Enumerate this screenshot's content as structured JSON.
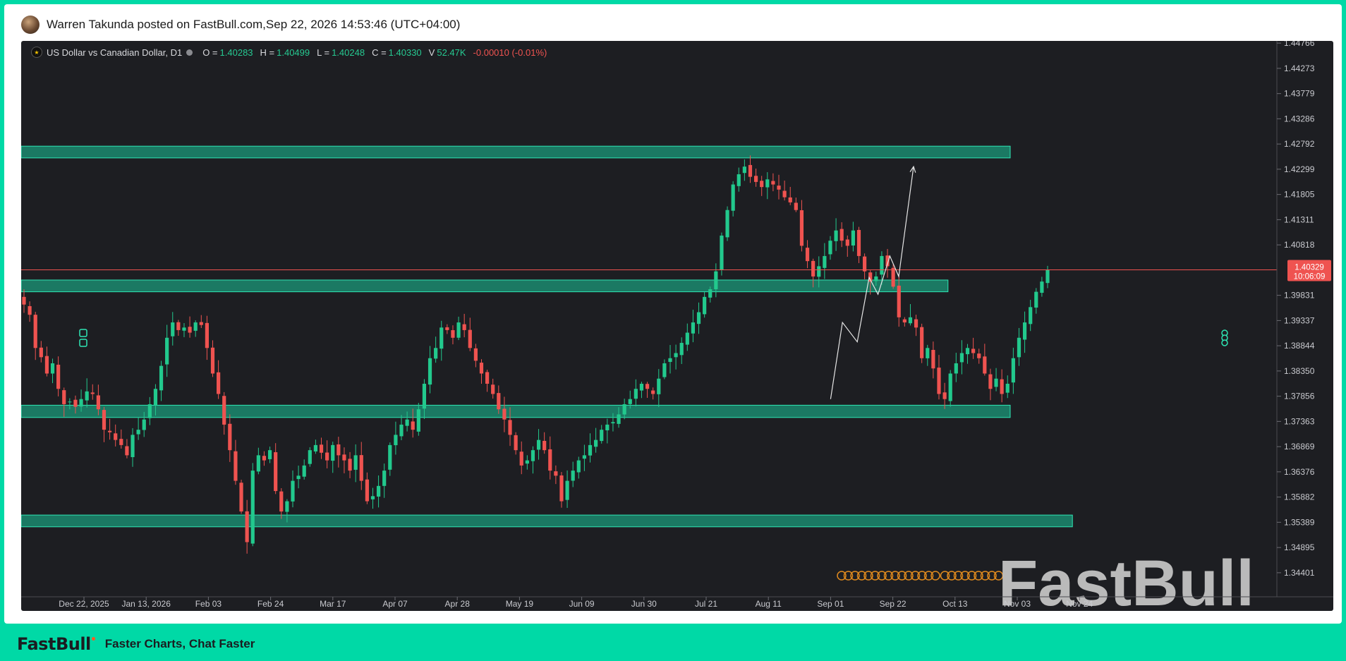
{
  "post": {
    "author_line": "Warren Takunda posted on FastBull.com",
    "separator": ",",
    "timestamp": "Sep 22, 2026 14:53:46 (UTC+04:00)"
  },
  "header": {
    "symbol": "US Dollar vs Canadian Dollar, D1",
    "o_label": "O =",
    "o_value": "1.40283",
    "h_label": "H =",
    "h_value": "1.40499",
    "l_label": "L =",
    "l_value": "1.40248",
    "c_label": "C =",
    "c_value": "1.40330",
    "v_label": "V",
    "v_value": "52.47K",
    "change": "-0.00010 (-0.01%)"
  },
  "colors": {
    "up": "#26a69a",
    "up_bright": "#22c98d",
    "down": "#ef5350",
    "zone_fill": "#1b8a6f",
    "zone_stroke": "#2ee6b4",
    "price_line": "#ef5350",
    "background": "#1d1e22",
    "frame": "#00d9a6"
  },
  "chart_data": {
    "type": "candlestick",
    "title": "US Dollar vs Canadian Dollar, D1",
    "ylim": [
      1.3393,
      1.4481
    ],
    "y_ticks": [
      "1.44766",
      "1.44273",
      "1.43779",
      "1.43286",
      "1.42792",
      "1.42299",
      "1.41805",
      "1.41311",
      "1.40818",
      "1.39831",
      "1.39337",
      "1.38844",
      "1.38350",
      "1.37856",
      "1.37363",
      "1.36869",
      "1.36376",
      "1.35882",
      "1.35389",
      "1.34895",
      "1.34401"
    ],
    "x_ticks": [
      "Dec 22, 2025",
      "Jan 13, 2026",
      "Feb 03",
      "Feb 24",
      "Mar 17",
      "Apr 07",
      "Apr 28",
      "May 19",
      "Jun 09",
      "Jun 30",
      "Jul 21",
      "Aug 11",
      "Sep 01",
      "Sep 22",
      "Oct 13",
      "Nov 03",
      "Nov 24"
    ],
    "last_price": "1.40329",
    "countdown": "10:06:09",
    "zones": [
      {
        "low": 1.4252,
        "high": 1.4275,
        "end_tick": "Nov 03"
      },
      {
        "low": 1.399,
        "high": 1.4013,
        "end_tick": "Oct 13"
      },
      {
        "low": 1.3744,
        "high": 1.3768,
        "end_tick": "Nov 03"
      },
      {
        "low": 1.353,
        "high": 1.3553,
        "end_tick": "Nov 24"
      }
    ],
    "projection": {
      "points": [
        [
          "Sep 01",
          1.378
        ],
        [
          "Sep 05",
          1.393
        ],
        [
          "Sep 10",
          1.3892
        ],
        [
          "Sep 14",
          1.4018
        ],
        [
          "Sep 17",
          1.3985
        ],
        [
          "Sep 21",
          1.406
        ],
        [
          "Sep 24",
          1.402
        ],
        [
          "Sep 29",
          1.4235
        ]
      ]
    },
    "closes": [
      1.3965,
      1.3945,
      1.388,
      1.3862,
      1.383,
      1.385,
      1.38,
      1.377,
      1.3775,
      1.3765,
      1.378,
      1.3795,
      1.379,
      1.376,
      1.372,
      1.3715,
      1.37,
      1.369,
      1.367,
      1.371,
      1.372,
      1.374,
      1.377,
      1.38,
      1.3845,
      1.39,
      1.393,
      1.3915,
      1.392,
      1.391,
      1.393,
      1.3925,
      1.388,
      1.383,
      1.379,
      1.373,
      1.368,
      1.362,
      1.356,
      1.35,
      1.364,
      1.367,
      1.366,
      1.368,
      1.36,
      1.356,
      1.358,
      1.362,
      1.363,
      1.365,
      1.368,
      1.369,
      1.3675,
      1.366,
      1.369,
      1.367,
      1.366,
      1.364,
      1.367,
      1.362,
      1.358,
      1.359,
      1.361,
      1.364,
      1.369,
      1.371,
      1.373,
      1.374,
      1.372,
      1.376,
      1.381,
      1.386,
      1.388,
      1.392,
      1.3915,
      1.39,
      1.393,
      1.3915,
      1.388,
      1.3855,
      1.383,
      1.381,
      1.379,
      1.376,
      1.374,
      1.371,
      1.368,
      1.365,
      1.366,
      1.368,
      1.37,
      1.368,
      1.364,
      1.363,
      1.358,
      1.362,
      1.364,
      1.366,
      1.367,
      1.369,
      1.37,
      1.372,
      1.373,
      1.3735,
      1.375,
      1.377,
      1.378,
      1.38,
      1.381,
      1.38,
      1.379,
      1.382,
      1.385,
      1.386,
      1.387,
      1.389,
      1.391,
      1.393,
      1.395,
      1.398,
      1.3995,
      1.403,
      1.41,
      1.415,
      1.42,
      1.422,
      1.4235,
      1.4215,
      1.4205,
      1.4195,
      1.421,
      1.42,
      1.419,
      1.4175,
      1.4165,
      1.415,
      1.408,
      1.405,
      1.402,
      1.404,
      1.406,
      1.409,
      1.411,
      1.409,
      1.408,
      1.411,
      1.406,
      1.403,
      1.401,
      1.402,
      1.406,
      1.404,
      1.4,
      1.394,
      1.393,
      1.394,
      1.392,
      1.386,
      1.388,
      1.384,
      1.379,
      1.378,
      1.383,
      1.385,
      1.387,
      1.388,
      1.387,
      1.386,
      1.383,
      1.38,
      1.382,
      1.379,
      1.381,
      1.386,
      1.39,
      1.393,
      1.396,
      1.399,
      1.401,
      1.4033
    ]
  }
}
